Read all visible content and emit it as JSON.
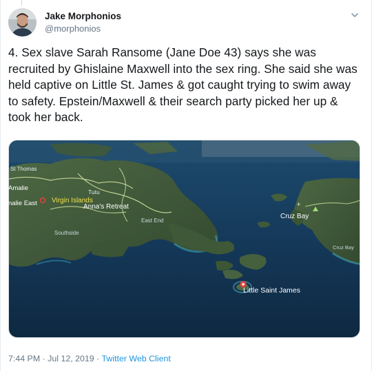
{
  "tweet": {
    "author_name": "Jake Morphonios",
    "author_handle": "@morphonios",
    "text": "4. Sex slave Sarah Ransome (Jane Doe 43) says she was recruited by Ghislaine Maxwell into the sex ring. She said she was held captive on Little St. James & got caught trying to swim away to safety. Epstein/Maxwell & their search party picked her up & took her back.",
    "time": "7:44 PM",
    "separator": " · ",
    "date": "Jul 12, 2019",
    "client": "Twitter Web Client"
  },
  "map": {
    "labels": {
      "st_thomas": "St Thomas",
      "amalie": "Amalie",
      "amalie_east": "nalie East",
      "virgin_islands": "Virgin Islands",
      "tutu": "Tutu",
      "annas_retreat": "Anna's Retreat",
      "east_end": "East End",
      "southside": "Southside",
      "cruz_bay": "Cruz Bay",
      "cruz_bay_small": "Cruz Bay",
      "little_saint_james": "Little Saint James"
    },
    "colors": {
      "sea_deep": "#0f2a44",
      "sea_mid": "#1c4a6a",
      "land": "#3f5a3a",
      "reef": "#3a8fa8",
      "pin": "#e0413b"
    }
  },
  "icons": {
    "menu": "chevron-down-icon"
  }
}
